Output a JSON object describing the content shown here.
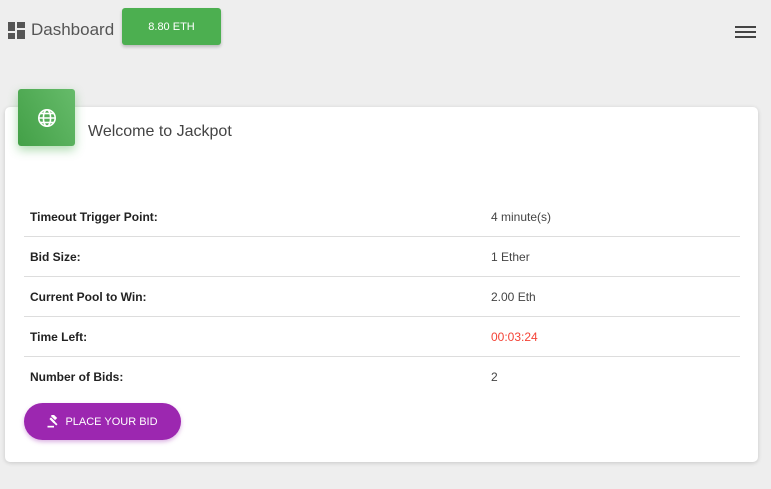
{
  "header": {
    "brand_label": "Dashboard",
    "balance_label": "8.80 ETH",
    "brand_icon": "dashboard-icon",
    "menu_icon": "hamburger-menu-icon"
  },
  "card": {
    "icon": "globe-icon",
    "title": "Welcome to Jackpot",
    "rows": [
      {
        "label": "Timeout Trigger Point:",
        "value": "4 minute(s)"
      },
      {
        "label": "Bid Size:",
        "value": "1 Ether"
      },
      {
        "label": "Current Pool to Win:",
        "value": "2.00 Eth"
      },
      {
        "label": "Time Left:",
        "value": "00:03:24"
      },
      {
        "label": "Number of Bids:",
        "value": "2"
      }
    ],
    "bid_button_label": "PLACE YOUR BID",
    "bid_button_icon": "gavel-icon"
  },
  "colors": {
    "background": "#eeeeee",
    "balance_button": "#4caf50",
    "card_icon": "#4caf50",
    "bid_button": "#9c27b0",
    "time_left": "#f44336"
  }
}
